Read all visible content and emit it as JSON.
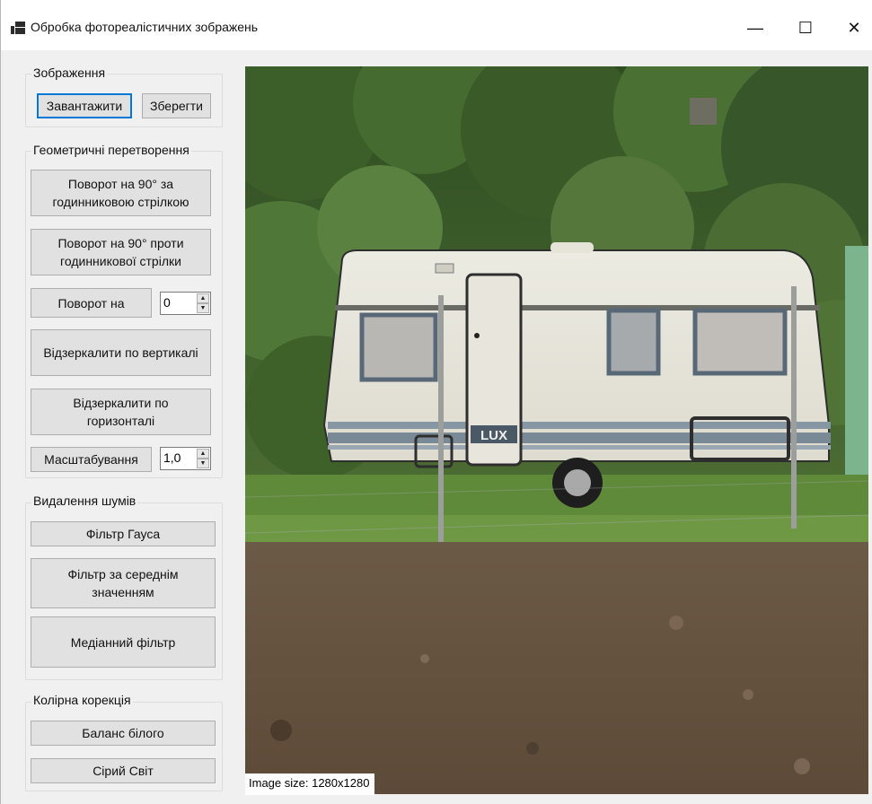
{
  "window": {
    "title": "Обробка фотореалістичних зображень",
    "minimize_glyph": "—",
    "maximize_glyph": "☐",
    "close_glyph": "✕"
  },
  "image_group": {
    "label": "Зображення",
    "load_button": "Завантажити",
    "save_button": "Зберегти"
  },
  "geometry_group": {
    "label": "Геометричні перетворення",
    "rotate_cw_line1": "Поворот на 90° за",
    "rotate_cw_line2": "годинниковою стрілкою",
    "rotate_ccw_line1": "Поворот на 90° проти",
    "rotate_ccw_line2": "годинникової стрілки",
    "rotate_by_button": "Поворот на",
    "rotate_angle_value": "0",
    "flip_vertical_button": "Відзеркалити по вертикалі",
    "flip_horizontal_line1": "Відзеркалити по",
    "flip_horizontal_line2": "горизонталі",
    "scale_button": "Масштабування",
    "scale_value": "1,0"
  },
  "noise_group": {
    "label": "Видалення шумів",
    "gauss_button": "Фільтр Гауса",
    "mean_line1": "Фільтр за середнім",
    "mean_line2": "значенням",
    "median_button": "Медіанний фільтр"
  },
  "color_group": {
    "label": "Колірна корекція",
    "white_balance_button": "Баланс білого",
    "gray_world_button": "Сірий Світ"
  },
  "status": {
    "image_size": "Image size: 1280x1280"
  },
  "spinner": {
    "up_glyph": "▲",
    "down_glyph": "▼"
  },
  "caravan_badge": "LUX",
  "colors": {
    "accent_focus": "#0078d7",
    "button_face": "#e1e1e1",
    "window_bg": "#f0f0f0"
  }
}
